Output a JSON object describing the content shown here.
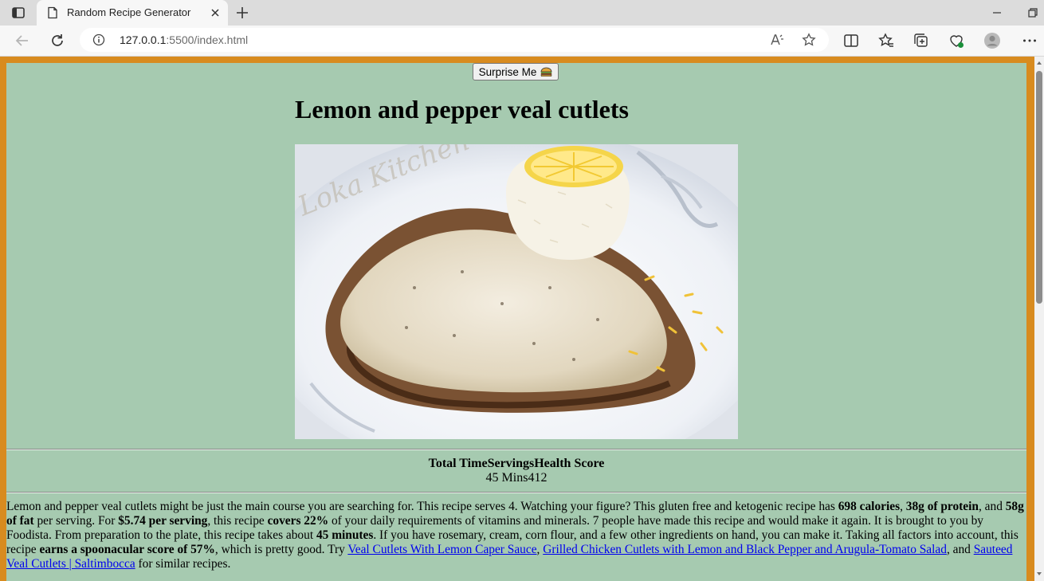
{
  "browser": {
    "tab_title": "Random Recipe Generator",
    "url_host": "127.0.0.1",
    "url_rest": ":5500/index.html"
  },
  "page": {
    "surprise_button_label": "Surprise Me",
    "recipe_title": "Lemon and pepper veal cutlets",
    "stats": {
      "headers": [
        "Total Time",
        "Servings",
        "Health Score"
      ],
      "values": [
        "45 Mins",
        "4",
        "12"
      ]
    },
    "summary": {
      "s1": "Lemon and pepper veal cutlets might be just the main course you are searching for. This recipe serves 4. Watching your figure? This gluten free and ketogenic recipe has ",
      "b1": "698 calories",
      "s2": ", ",
      "b2": "38g of protein",
      "s3": ", and ",
      "b3": "58g of fat",
      "s4": " per serving. For ",
      "b4": "$5.74 per serving",
      "s5": ", this recipe ",
      "b5": "covers 22%",
      "s6": " of your daily requirements of vitamins and minerals. 7 people have made this recipe and would make it again. It is brought to you by Foodista. From preparation to the plate, this recipe takes about ",
      "b6": "45 minutes",
      "s7": ". If you have rosemary, cream, corn flour, and a few other ingredients on hand, you can make it. Taking all factors into account, this recipe ",
      "b7": "earns a spoonacular score of 57%",
      "s8": ", which is pretty good. Try ",
      "link1": "Veal Cutlets With Lemon Caper Sauce",
      "s9": ", ",
      "link2": "Grilled Chicken Cutlets with Lemon and Black Pepper and Arugula-Tomato Salad",
      "s10": ", and ",
      "link3": "Sauteed Veal Cutlets | Saltimbocca",
      "s11": " for similar recipes."
    },
    "photo_watermark": "Loka Kitchen"
  },
  "colors": {
    "page_border": "#d88b1f",
    "panel_background": "#a6cab0",
    "link": "#0000ee"
  }
}
